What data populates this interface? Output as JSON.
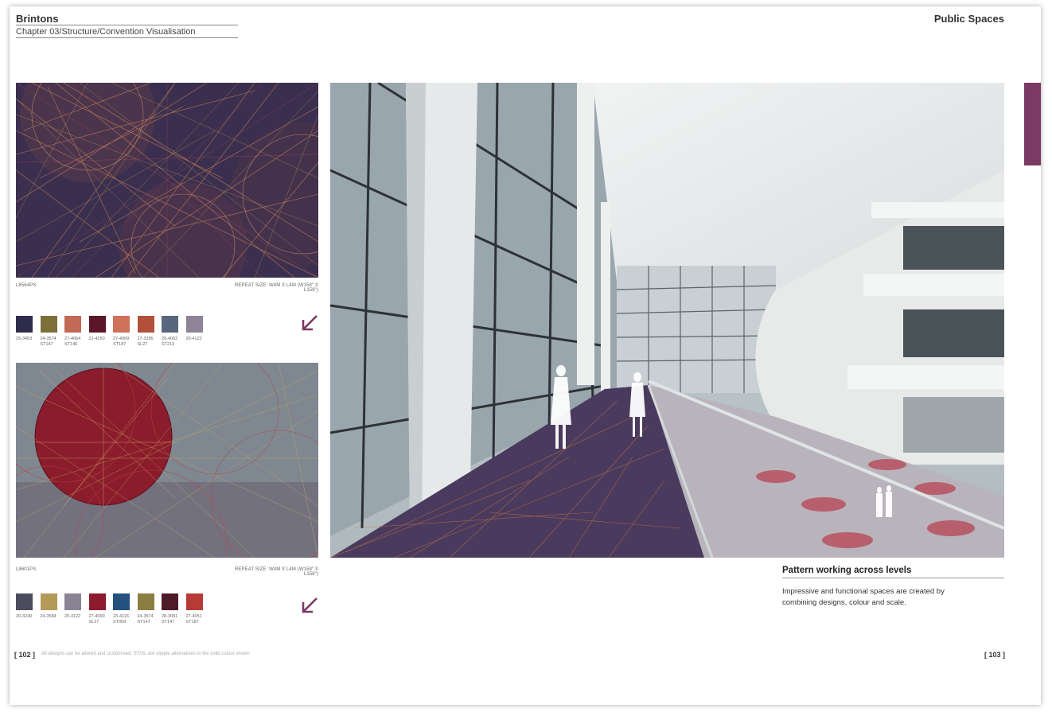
{
  "header": {
    "brand": "Brintons",
    "breadcrumb": "Chapter 03/Structure/Convention Visualisation",
    "section": "Public Spaces"
  },
  "colors": {
    "accent": "#7a3a63",
    "pattern1_bg": "#3b2f4f",
    "pattern2_bg": "#7f8791",
    "pattern2_circle": "#8a1c2c"
  },
  "designs": [
    {
      "code": "L8564PS",
      "repeat": "REPEAT SIZE: W4M X L4M (W158\" X L158\")",
      "arrow_icon": "arrow-down-left-icon",
      "swatches": [
        {
          "color": "#2f2b4c",
          "label": "29-3453"
        },
        {
          "color": "#7d6f3a",
          "label": "24-3574\nST147"
        },
        {
          "color": "#c26a55",
          "label": "27-4064\nST146"
        },
        {
          "color": "#5b1629",
          "label": "21-4250"
        },
        {
          "color": "#d07159",
          "label": "27-4069\nST187"
        },
        {
          "color": "#b2503a",
          "label": "27-3395\nSL27"
        },
        {
          "color": "#58677e",
          "label": "20-4062\nST213"
        },
        {
          "color": "#8d8497",
          "label": "20-4122"
        }
      ]
    },
    {
      "code": "L8601PS",
      "repeat": "REPEAT SIZE: W4M X L4M (W158\" X L158\")",
      "arrow_icon": "arrow-down-left-icon",
      "swatches": [
        {
          "color": "#4b4b5b",
          "label": "20-3240"
        },
        {
          "color": "#b39a57",
          "label": "24-3584"
        },
        {
          "color": "#8a8394",
          "label": "20-4122"
        },
        {
          "color": "#8d1a2e",
          "label": "27-4090\nSL27"
        },
        {
          "color": "#24527c",
          "label": "23-4116\nST059"
        },
        {
          "color": "#8c7d40",
          "label": "24-3574\nST147"
        },
        {
          "color": "#4d1a29",
          "label": "28-3081\nST147"
        },
        {
          "color": "#b73a35",
          "label": "27-4051\nST187"
        }
      ]
    }
  ],
  "caption": {
    "title": "Pattern working across levels",
    "body": "Impressive and functional spaces are created by combining designs, colour and scale."
  },
  "footer": {
    "left_page": "[ 102 ]",
    "right_page": "[ 103 ]",
    "note": "All designs can be altered and customised. ST/SL are stipple alternatives to the solid colour shown"
  }
}
